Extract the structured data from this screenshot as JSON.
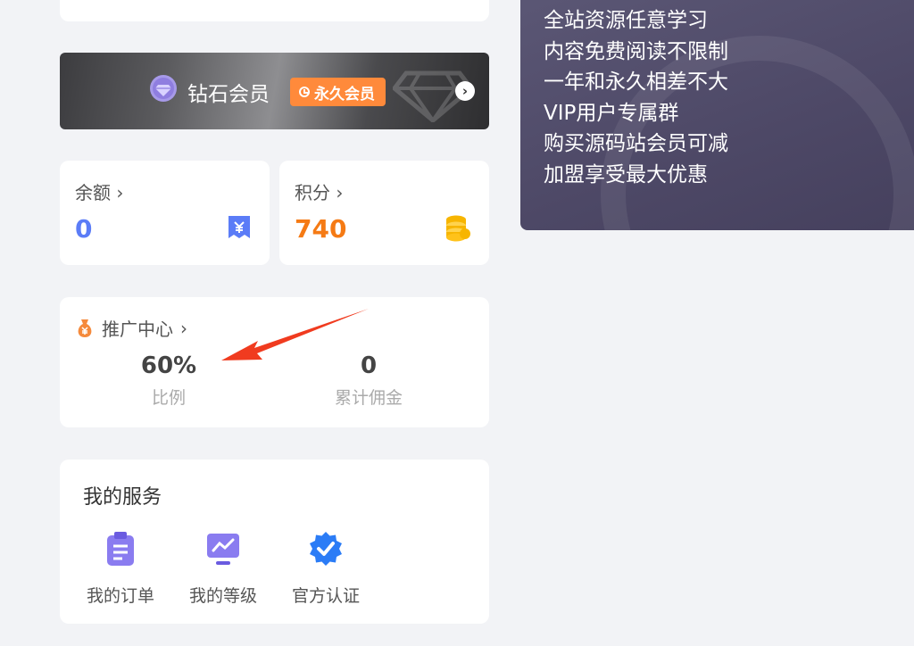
{
  "top_card": {
    "labels": [
      "",
      "",
      "",
      "",
      ""
    ]
  },
  "vip": {
    "title": "钻石会员",
    "badge": "永久会员",
    "colors": {
      "badge": "#ff8a3b",
      "gem": "#a79ae9"
    }
  },
  "balance": {
    "label": "余额",
    "value": "0",
    "color": "#5b7cf7"
  },
  "points": {
    "label": "积分",
    "value": "740",
    "color": "#f57a14"
  },
  "promotion": {
    "title": "推广中心",
    "stats": [
      {
        "value": "60%",
        "label": "比例"
      },
      {
        "value": "0",
        "label": "累计佣金"
      }
    ]
  },
  "services": {
    "title": "我的服务",
    "items": [
      {
        "label": "我的订单",
        "icon": "clipboard-icon"
      },
      {
        "label": "我的等级",
        "icon": "chart-icon"
      },
      {
        "label": "官方认证",
        "icon": "verified-icon"
      }
    ]
  },
  "benefits": [
    "全站资源任意学习",
    "内容免费阅读不限制",
    "一年和永久相差不大",
    "VIP用户专属群",
    "购买源码站会员可减",
    "加盟享受最大优惠"
  ]
}
